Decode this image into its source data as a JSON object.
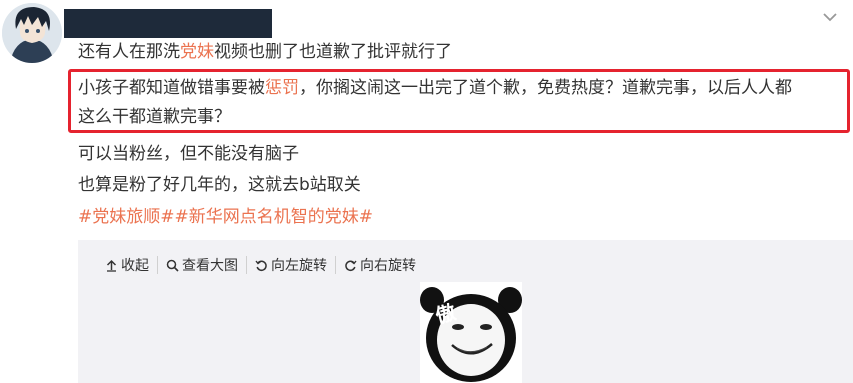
{
  "post": {
    "icons": {
      "avatar": "user-avatar",
      "chevron": "chevron-down-icon"
    },
    "lines": [
      {
        "parts": [
          {
            "text": "还有人在那洗",
            "kw": false
          },
          {
            "text": "党妹",
            "kw": true
          },
          {
            "text": "视频也删了也道歉了批评就行了",
            "kw": false
          }
        ]
      },
      {
        "parts": [
          {
            "text": "小孩子都知道做错事要被",
            "kw": false
          },
          {
            "text": "惩罚",
            "kw": true
          },
          {
            "text": "，你搁这闹这一出完了道个歉，免费热度？道歉完事，以后人人都",
            "kw": false
          }
        ]
      },
      {
        "parts": [
          {
            "text": "这么干都道歉完事？",
            "kw": false
          }
        ]
      },
      {
        "parts": [
          {
            "text": "可以当粉丝，但不能没有脑子",
            "kw": false
          }
        ]
      },
      {
        "parts": [
          {
            "text": "也算是粉了好几年的，这就去b站取关",
            "kw": false
          }
        ]
      }
    ],
    "hashtags": {
      "tag1": "#党妹旅顺#",
      "tag2_prefix": "#新华网点名机智的",
      "tag2_keyword": "党妹",
      "tag2_suffix": "#"
    },
    "highlight_color": "#e5232f",
    "keyword_color": "#eb7350"
  },
  "media_toolbar": {
    "collapse": {
      "label": "收起",
      "icon": "arrow-up-icon"
    },
    "view_large": {
      "label": "查看大图",
      "icon": "search-icon"
    },
    "rotate_left": {
      "label": "向左旋转",
      "icon": "rotate-left-icon"
    },
    "rotate_right": {
      "label": "向右旋转",
      "icon": "rotate-right-icon"
    }
  },
  "media": {
    "image": "panda-meme-sticker",
    "sticker_text": "傲"
  }
}
